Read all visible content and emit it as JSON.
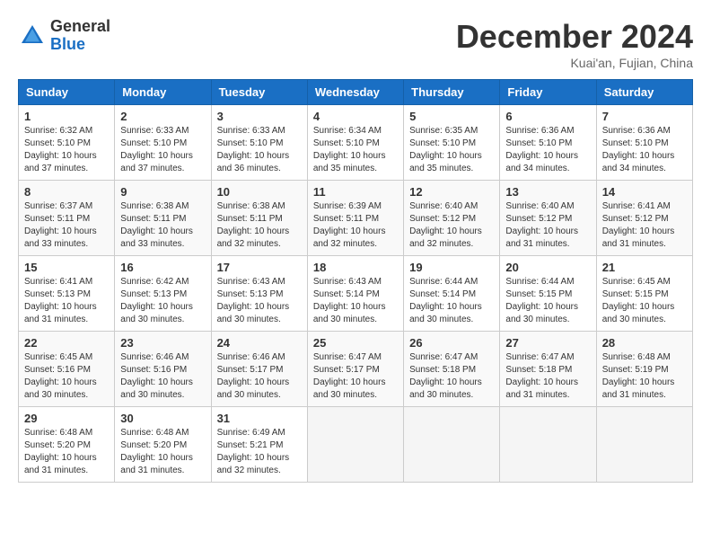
{
  "header": {
    "logo_general": "General",
    "logo_blue": "Blue",
    "title": "December 2024",
    "location": "Kuai'an, Fujian, China"
  },
  "calendar": {
    "days_of_week": [
      "Sunday",
      "Monday",
      "Tuesday",
      "Wednesday",
      "Thursday",
      "Friday",
      "Saturday"
    ],
    "weeks": [
      [
        null,
        {
          "day": "2",
          "sunrise": "6:33 AM",
          "sunset": "5:10 PM",
          "daylight": "10 hours and 37 minutes."
        },
        {
          "day": "3",
          "sunrise": "6:33 AM",
          "sunset": "5:10 PM",
          "daylight": "10 hours and 36 minutes."
        },
        {
          "day": "4",
          "sunrise": "6:34 AM",
          "sunset": "5:10 PM",
          "daylight": "10 hours and 35 minutes."
        },
        {
          "day": "5",
          "sunrise": "6:35 AM",
          "sunset": "5:10 PM",
          "daylight": "10 hours and 35 minutes."
        },
        {
          "day": "6",
          "sunrise": "6:36 AM",
          "sunset": "5:10 PM",
          "daylight": "10 hours and 34 minutes."
        },
        {
          "day": "7",
          "sunrise": "6:36 AM",
          "sunset": "5:10 PM",
          "daylight": "10 hours and 34 minutes."
        }
      ],
      [
        {
          "day": "1",
          "sunrise": "6:32 AM",
          "sunset": "5:10 PM",
          "daylight": "10 hours and 37 minutes."
        },
        {
          "day": "9",
          "sunrise": "6:38 AM",
          "sunset": "5:11 PM",
          "daylight": "10 hours and 33 minutes."
        },
        {
          "day": "10",
          "sunrise": "6:38 AM",
          "sunset": "5:11 PM",
          "daylight": "10 hours and 32 minutes."
        },
        {
          "day": "11",
          "sunrise": "6:39 AM",
          "sunset": "5:11 PM",
          "daylight": "10 hours and 32 minutes."
        },
        {
          "day": "12",
          "sunrise": "6:40 AM",
          "sunset": "5:12 PM",
          "daylight": "10 hours and 32 minutes."
        },
        {
          "day": "13",
          "sunrise": "6:40 AM",
          "sunset": "5:12 PM",
          "daylight": "10 hours and 31 minutes."
        },
        {
          "day": "14",
          "sunrise": "6:41 AM",
          "sunset": "5:12 PM",
          "daylight": "10 hours and 31 minutes."
        }
      ],
      [
        {
          "day": "8",
          "sunrise": "6:37 AM",
          "sunset": "5:11 PM",
          "daylight": "10 hours and 33 minutes."
        },
        {
          "day": "16",
          "sunrise": "6:42 AM",
          "sunset": "5:13 PM",
          "daylight": "10 hours and 30 minutes."
        },
        {
          "day": "17",
          "sunrise": "6:43 AM",
          "sunset": "5:13 PM",
          "daylight": "10 hours and 30 minutes."
        },
        {
          "day": "18",
          "sunrise": "6:43 AM",
          "sunset": "5:14 PM",
          "daylight": "10 hours and 30 minutes."
        },
        {
          "day": "19",
          "sunrise": "6:44 AM",
          "sunset": "5:14 PM",
          "daylight": "10 hours and 30 minutes."
        },
        {
          "day": "20",
          "sunrise": "6:44 AM",
          "sunset": "5:15 PM",
          "daylight": "10 hours and 30 minutes."
        },
        {
          "day": "21",
          "sunrise": "6:45 AM",
          "sunset": "5:15 PM",
          "daylight": "10 hours and 30 minutes."
        }
      ],
      [
        {
          "day": "15",
          "sunrise": "6:41 AM",
          "sunset": "5:13 PM",
          "daylight": "10 hours and 31 minutes."
        },
        {
          "day": "23",
          "sunrise": "6:46 AM",
          "sunset": "5:16 PM",
          "daylight": "10 hours and 30 minutes."
        },
        {
          "day": "24",
          "sunrise": "6:46 AM",
          "sunset": "5:17 PM",
          "daylight": "10 hours and 30 minutes."
        },
        {
          "day": "25",
          "sunrise": "6:47 AM",
          "sunset": "5:17 PM",
          "daylight": "10 hours and 30 minutes."
        },
        {
          "day": "26",
          "sunrise": "6:47 AM",
          "sunset": "5:18 PM",
          "daylight": "10 hours and 30 minutes."
        },
        {
          "day": "27",
          "sunrise": "6:47 AM",
          "sunset": "5:18 PM",
          "daylight": "10 hours and 31 minutes."
        },
        {
          "day": "28",
          "sunrise": "6:48 AM",
          "sunset": "5:19 PM",
          "daylight": "10 hours and 31 minutes."
        }
      ],
      [
        {
          "day": "22",
          "sunrise": "6:45 AM",
          "sunset": "5:16 PM",
          "daylight": "10 hours and 30 minutes."
        },
        {
          "day": "30",
          "sunrise": "6:48 AM",
          "sunset": "5:20 PM",
          "daylight": "10 hours and 31 minutes."
        },
        {
          "day": "31",
          "sunrise": "6:49 AM",
          "sunset": "5:21 PM",
          "daylight": "10 hours and 32 minutes."
        },
        null,
        null,
        null,
        null
      ],
      [
        {
          "day": "29",
          "sunrise": "6:48 AM",
          "sunset": "5:20 PM",
          "daylight": "10 hours and 31 minutes."
        },
        null,
        null,
        null,
        null,
        null,
        null
      ]
    ]
  }
}
